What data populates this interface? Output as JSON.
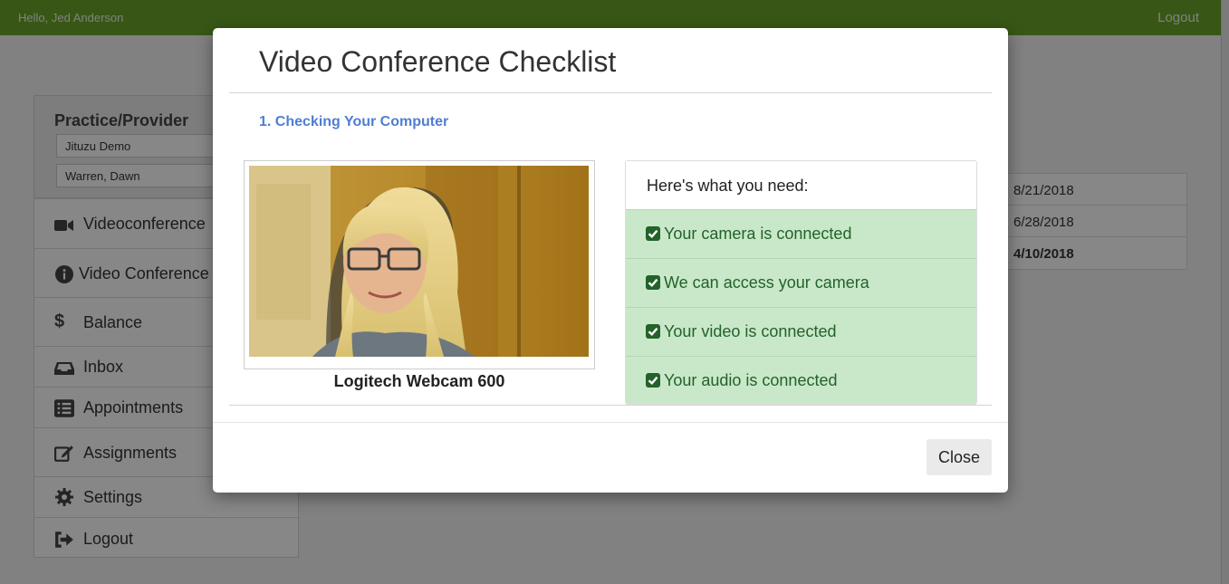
{
  "header": {
    "greeting": "Hello, Jed Anderson",
    "logout_label": "Logout"
  },
  "sidebar": {
    "title": "Practice/Provider",
    "practice_select": "Jituzu Demo",
    "provider_select": "Warren, Dawn",
    "items": [
      {
        "label": "Videoconference",
        "icon": "video-camera-icon"
      },
      {
        "label": "Video Conference Checklist",
        "icon": "info-circle-icon"
      },
      {
        "label": "Balance",
        "icon": "dollar-icon"
      },
      {
        "label": "Inbox",
        "icon": "inbox-tray-icon"
      },
      {
        "label": "Appointments",
        "icon": "list-icon"
      },
      {
        "label": "Assignments",
        "icon": "edit-icon"
      },
      {
        "label": "Settings",
        "icon": "gear-icon"
      },
      {
        "label": "Logout",
        "icon": "sign-out-icon"
      }
    ]
  },
  "dates_table": [
    "8/21/2018",
    "6/28/2018",
    "4/10/2018"
  ],
  "modal": {
    "title": "Video Conference Checklist",
    "step_label": "1. Checking Your Computer",
    "camera_name": "Logitech Webcam 600",
    "needs_header": "Here's what you need:",
    "checklist": [
      "Your camera is connected",
      "We can access your camera",
      "Your video is connected",
      "Your audio is connected"
    ],
    "close_label": "Close"
  },
  "colors": {
    "topbar": "#6aa52a",
    "step_link": "#4f7ed2",
    "check_bg": "#c9e8c9",
    "check_text": "#23622a"
  }
}
